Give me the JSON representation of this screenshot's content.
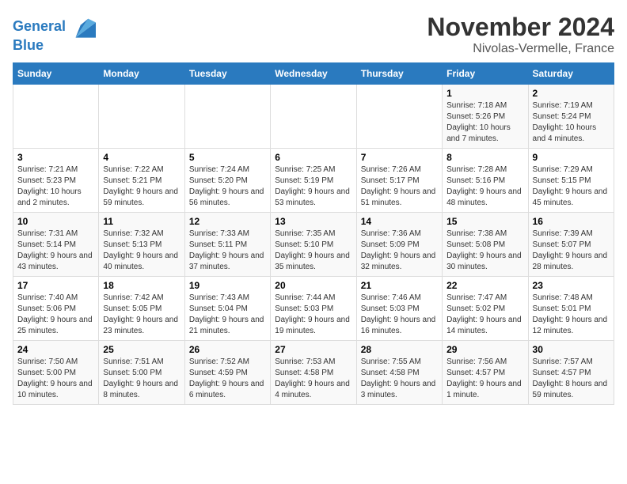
{
  "logo": {
    "line1": "General",
    "line2": "Blue"
  },
  "title": "November 2024",
  "subtitle": "Nivolas-Vermelle, France",
  "weekdays": [
    "Sunday",
    "Monday",
    "Tuesday",
    "Wednesday",
    "Thursday",
    "Friday",
    "Saturday"
  ],
  "weeks": [
    [
      {
        "day": "",
        "info": ""
      },
      {
        "day": "",
        "info": ""
      },
      {
        "day": "",
        "info": ""
      },
      {
        "day": "",
        "info": ""
      },
      {
        "day": "",
        "info": ""
      },
      {
        "day": "1",
        "info": "Sunrise: 7:18 AM\nSunset: 5:26 PM\nDaylight: 10 hours and 7 minutes."
      },
      {
        "day": "2",
        "info": "Sunrise: 7:19 AM\nSunset: 5:24 PM\nDaylight: 10 hours and 4 minutes."
      }
    ],
    [
      {
        "day": "3",
        "info": "Sunrise: 7:21 AM\nSunset: 5:23 PM\nDaylight: 10 hours and 2 minutes."
      },
      {
        "day": "4",
        "info": "Sunrise: 7:22 AM\nSunset: 5:21 PM\nDaylight: 9 hours and 59 minutes."
      },
      {
        "day": "5",
        "info": "Sunrise: 7:24 AM\nSunset: 5:20 PM\nDaylight: 9 hours and 56 minutes."
      },
      {
        "day": "6",
        "info": "Sunrise: 7:25 AM\nSunset: 5:19 PM\nDaylight: 9 hours and 53 minutes."
      },
      {
        "day": "7",
        "info": "Sunrise: 7:26 AM\nSunset: 5:17 PM\nDaylight: 9 hours and 51 minutes."
      },
      {
        "day": "8",
        "info": "Sunrise: 7:28 AM\nSunset: 5:16 PM\nDaylight: 9 hours and 48 minutes."
      },
      {
        "day": "9",
        "info": "Sunrise: 7:29 AM\nSunset: 5:15 PM\nDaylight: 9 hours and 45 minutes."
      }
    ],
    [
      {
        "day": "10",
        "info": "Sunrise: 7:31 AM\nSunset: 5:14 PM\nDaylight: 9 hours and 43 minutes."
      },
      {
        "day": "11",
        "info": "Sunrise: 7:32 AM\nSunset: 5:13 PM\nDaylight: 9 hours and 40 minutes."
      },
      {
        "day": "12",
        "info": "Sunrise: 7:33 AM\nSunset: 5:11 PM\nDaylight: 9 hours and 37 minutes."
      },
      {
        "day": "13",
        "info": "Sunrise: 7:35 AM\nSunset: 5:10 PM\nDaylight: 9 hours and 35 minutes."
      },
      {
        "day": "14",
        "info": "Sunrise: 7:36 AM\nSunset: 5:09 PM\nDaylight: 9 hours and 32 minutes."
      },
      {
        "day": "15",
        "info": "Sunrise: 7:38 AM\nSunset: 5:08 PM\nDaylight: 9 hours and 30 minutes."
      },
      {
        "day": "16",
        "info": "Sunrise: 7:39 AM\nSunset: 5:07 PM\nDaylight: 9 hours and 28 minutes."
      }
    ],
    [
      {
        "day": "17",
        "info": "Sunrise: 7:40 AM\nSunset: 5:06 PM\nDaylight: 9 hours and 25 minutes."
      },
      {
        "day": "18",
        "info": "Sunrise: 7:42 AM\nSunset: 5:05 PM\nDaylight: 9 hours and 23 minutes."
      },
      {
        "day": "19",
        "info": "Sunrise: 7:43 AM\nSunset: 5:04 PM\nDaylight: 9 hours and 21 minutes."
      },
      {
        "day": "20",
        "info": "Sunrise: 7:44 AM\nSunset: 5:03 PM\nDaylight: 9 hours and 19 minutes."
      },
      {
        "day": "21",
        "info": "Sunrise: 7:46 AM\nSunset: 5:03 PM\nDaylight: 9 hours and 16 minutes."
      },
      {
        "day": "22",
        "info": "Sunrise: 7:47 AM\nSunset: 5:02 PM\nDaylight: 9 hours and 14 minutes."
      },
      {
        "day": "23",
        "info": "Sunrise: 7:48 AM\nSunset: 5:01 PM\nDaylight: 9 hours and 12 minutes."
      }
    ],
    [
      {
        "day": "24",
        "info": "Sunrise: 7:50 AM\nSunset: 5:00 PM\nDaylight: 9 hours and 10 minutes."
      },
      {
        "day": "25",
        "info": "Sunrise: 7:51 AM\nSunset: 5:00 PM\nDaylight: 9 hours and 8 minutes."
      },
      {
        "day": "26",
        "info": "Sunrise: 7:52 AM\nSunset: 4:59 PM\nDaylight: 9 hours and 6 minutes."
      },
      {
        "day": "27",
        "info": "Sunrise: 7:53 AM\nSunset: 4:58 PM\nDaylight: 9 hours and 4 minutes."
      },
      {
        "day": "28",
        "info": "Sunrise: 7:55 AM\nSunset: 4:58 PM\nDaylight: 9 hours and 3 minutes."
      },
      {
        "day": "29",
        "info": "Sunrise: 7:56 AM\nSunset: 4:57 PM\nDaylight: 9 hours and 1 minute."
      },
      {
        "day": "30",
        "info": "Sunrise: 7:57 AM\nSunset: 4:57 PM\nDaylight: 8 hours and 59 minutes."
      }
    ]
  ]
}
